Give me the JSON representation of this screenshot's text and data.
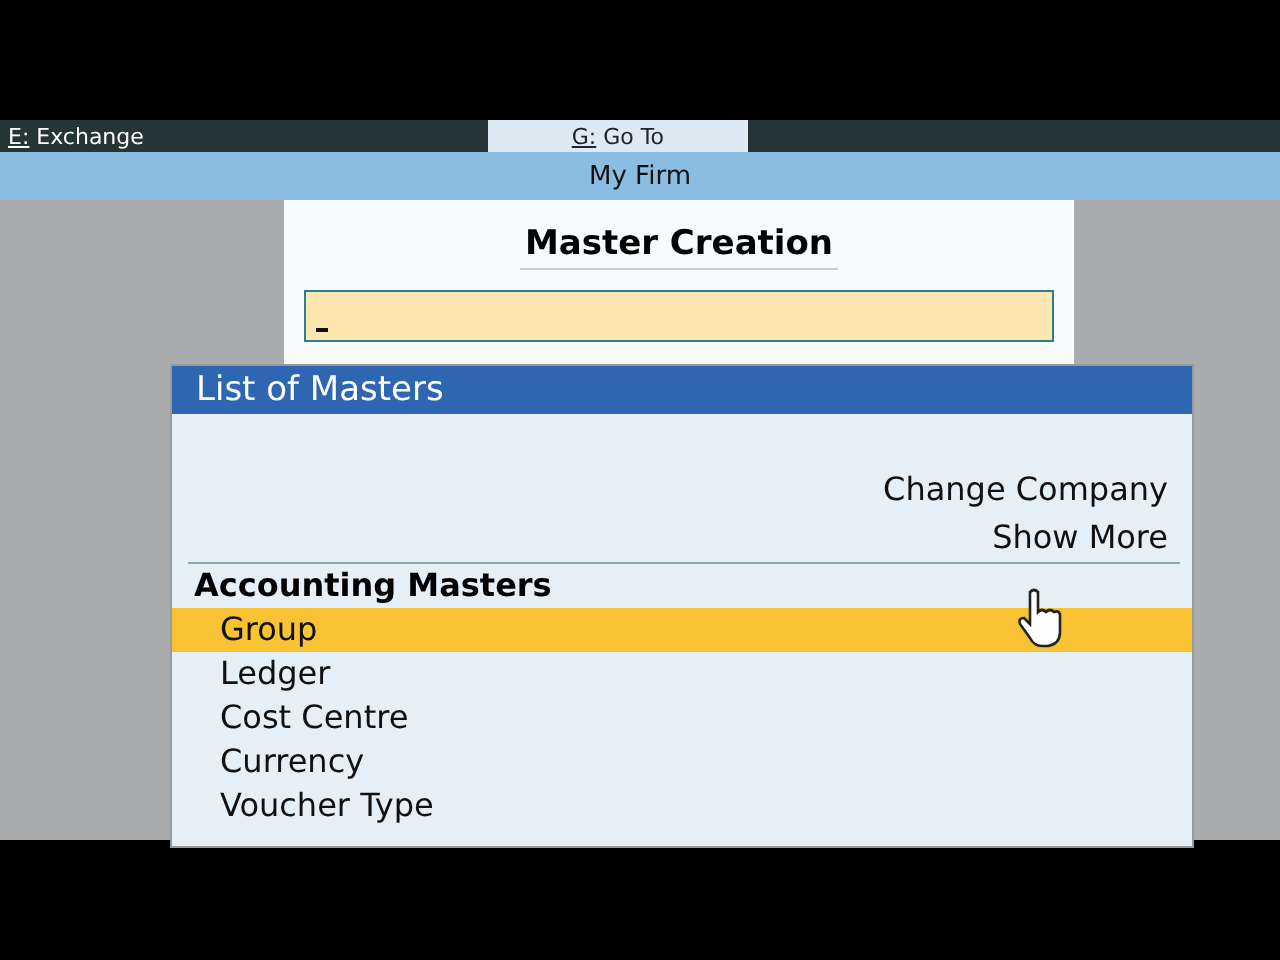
{
  "top_bar": {
    "items": [
      {
        "key": "E:",
        "label": "Exchange",
        "selected": false
      },
      {
        "key": "G:",
        "label": "Go To",
        "selected": true
      }
    ]
  },
  "company_bar": {
    "title": "My Firm"
  },
  "master_creation": {
    "title": "Master Creation"
  },
  "list_of_masters": {
    "title": "List of Masters",
    "actions": [
      "Change Company",
      "Show More"
    ],
    "sections": [
      {
        "heading": "Accounting Masters",
        "items": [
          {
            "label": "Group",
            "selected": true
          },
          {
            "label": "Ledger",
            "selected": false
          },
          {
            "label": "Cost Centre",
            "selected": false
          },
          {
            "label": "Currency",
            "selected": false
          },
          {
            "label": "Voucher Type",
            "selected": false
          }
        ]
      }
    ]
  }
}
